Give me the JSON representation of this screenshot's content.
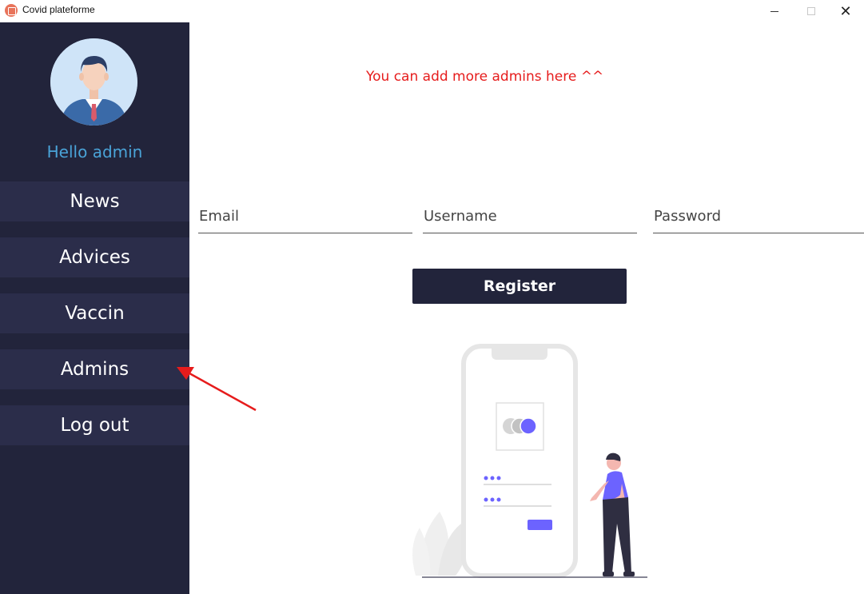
{
  "window": {
    "title": "Covid plateforme",
    "minimize_glyph": "",
    "maximize_glyph": "",
    "close_glyph": "✕"
  },
  "sidebar": {
    "greeting": "Hello admin",
    "items": [
      {
        "label": "News"
      },
      {
        "label": "Advices"
      },
      {
        "label": "Vaccin"
      },
      {
        "label": "Admins"
      },
      {
        "label": "Log out"
      }
    ]
  },
  "main": {
    "hint": "You can add more admins here ^^",
    "form": {
      "email_placeholder": "Email",
      "username_placeholder": "Username",
      "password_placeholder": "Password",
      "register_label": "Register"
    }
  },
  "colors": {
    "sidebar_bg": "#22243b",
    "nav_item_bg": "#2b2d4a",
    "greeting": "#4aa3d8",
    "hint": "#e61c1c",
    "accent": "#6c63ff"
  },
  "icons": {
    "app": "app-logo-icon",
    "avatar": "user-avatar-icon",
    "arrow": "red-arrow-annotation"
  }
}
